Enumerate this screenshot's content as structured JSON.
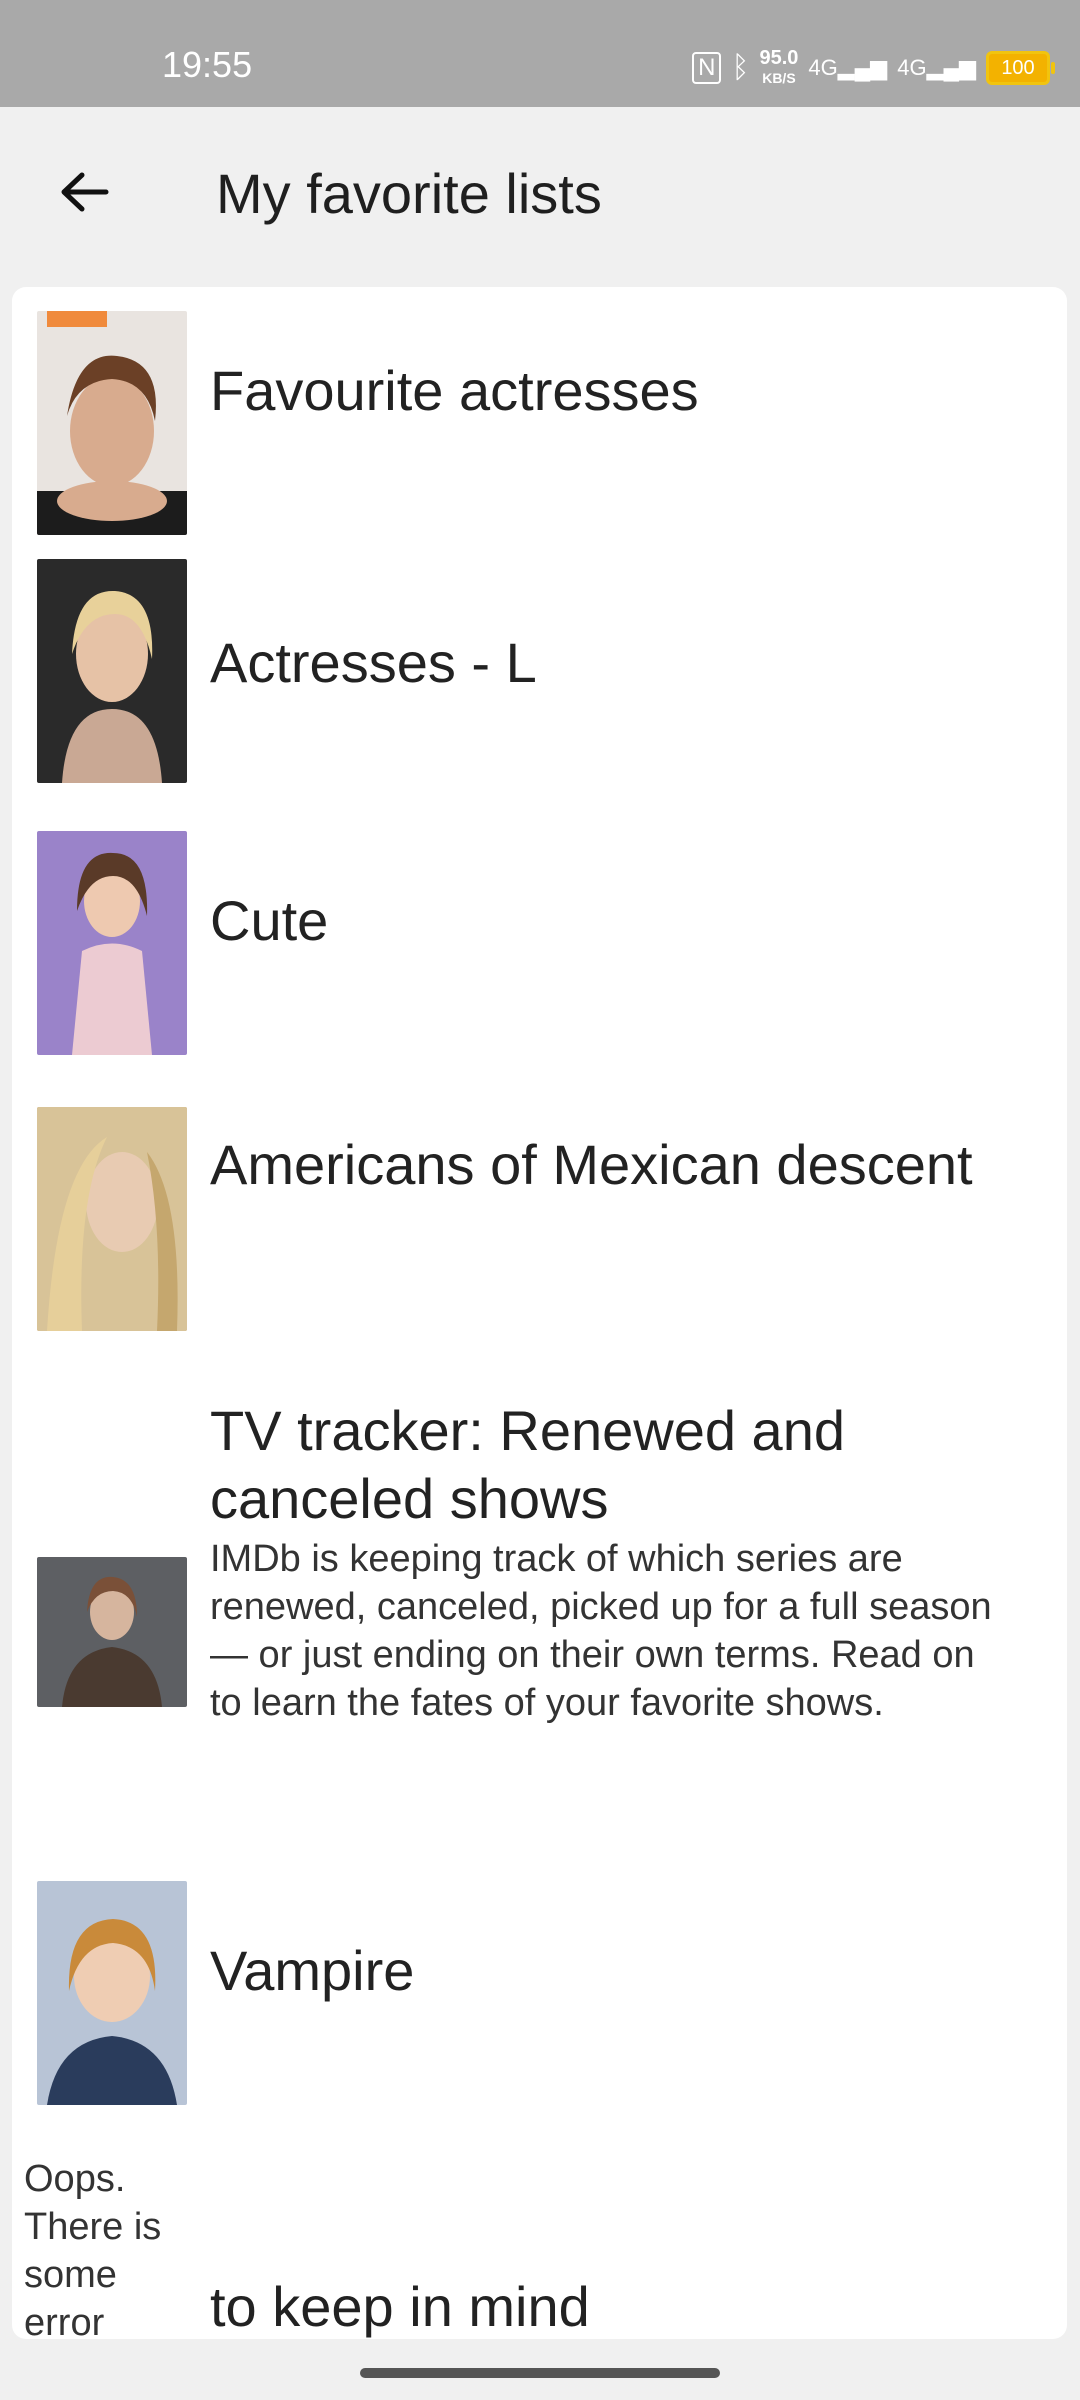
{
  "status": {
    "time": "19:55",
    "nfc": "N",
    "speed_value": "95.0",
    "speed_unit": "KB/S",
    "net1": "4G",
    "net2": "4G",
    "battery": "100"
  },
  "header": {
    "title": "My favorite lists"
  },
  "lists": [
    {
      "title": "Favourite actresses",
      "thumb": "portrait-brown-hair"
    },
    {
      "title": "Actresses - L",
      "thumb": "portrait-blonde"
    },
    {
      "title": "Cute",
      "thumb": "portrait-purple-backdrop"
    },
    {
      "title": "Americans of Mexican descent",
      "thumb": "portrait-long-blonde"
    },
    {
      "title": "TV tracker: Renewed and canceled shows",
      "description": "IMDb is keeping track of which series are renewed, canceled, picked up for a full season — or just ending on their own terms. Read on to learn the fates of your favorite shows.",
      "thumb": "portrait-street"
    },
    {
      "title": "Vampire",
      "thumb": "portrait-child"
    },
    {
      "title": "to keep in mind"
    }
  ],
  "error_text": "Oops. There is some error",
  "colors": {
    "statusbar": "#a9a9a9",
    "background": "#f0f0f0",
    "card": "#ffffff",
    "battery": "#f3b200"
  }
}
